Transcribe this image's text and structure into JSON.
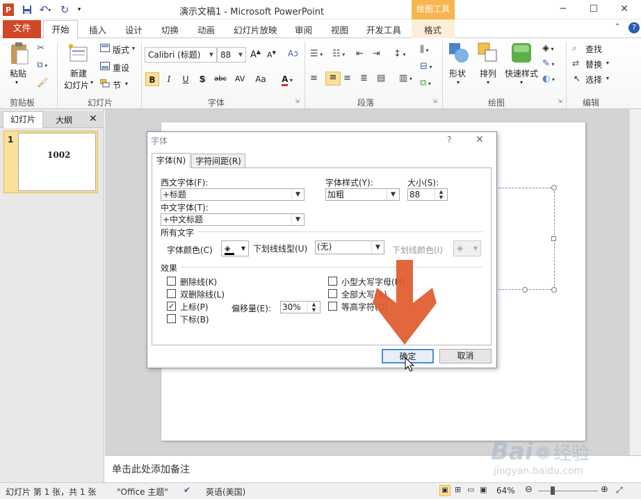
{
  "titlebar": {
    "title": "演示文稿1 - Microsoft PowerPoint",
    "drawing_tools": "绘图工具",
    "minimize": "─",
    "restore": "☐",
    "close": "✕"
  },
  "tabs": {
    "file": "文件",
    "home": "开始",
    "insert": "插入",
    "design": "设计",
    "transitions": "切换",
    "animations": "动画",
    "slideshow": "幻灯片放映",
    "review": "审阅",
    "view": "视图",
    "developer": "开发工具",
    "format": "格式"
  },
  "ribbon": {
    "clipboard": {
      "paste": "粘贴",
      "label": "剪贴板"
    },
    "slides": {
      "new_slide": "新建",
      "new_slide2": "幻灯片",
      "layout": "版式",
      "reset": "重设",
      "section": "节",
      "label": "幻灯片"
    },
    "font": {
      "name": "Calibri (标题)",
      "size": "88",
      "label": "字体",
      "bold": "B",
      "italic": "I",
      "underline": "U",
      "shadow": "S",
      "strike": "abc",
      "spacing": "AV",
      "case": "Aa",
      "color": "A"
    },
    "paragraph": {
      "label": "段落"
    },
    "drawing": {
      "shapes": "形状",
      "arrange": "排列",
      "quick_styles": "快速样式",
      "label": "绘图"
    },
    "editing": {
      "find": "查找",
      "replace": "替换",
      "select": "选择",
      "label": "编辑"
    }
  },
  "leftpane": {
    "tab_slides": "幻灯片",
    "tab_outline": "大纲",
    "slide_number": "1",
    "slide_text": "1002"
  },
  "notes": {
    "placeholder": "单击此处添加备注"
  },
  "statusbar": {
    "slide_info": "幻灯片 第 1 张，共 1 张",
    "theme": "\"Office 主题\"",
    "language": "英语(美国)",
    "zoom": "64%"
  },
  "dialog": {
    "title": "字体",
    "help": "?",
    "close": "✕",
    "tab_font": "字体(N)",
    "tab_spacing": "字符间距(R)",
    "latin_font_label": "西文字体(F):",
    "latin_font_value": "+标题",
    "asian_font_label": "中文字体(T):",
    "asian_font_value": "+中文标题",
    "style_label": "字体样式(Y):",
    "style_value": "加粗",
    "size_label": "大小(S):",
    "size_value": "88",
    "all_text": "所有文字",
    "font_color_label": "字体颜色(C)",
    "underline_style_label": "下划线线型(U)",
    "underline_style_value": "(无)",
    "underline_color_label": "下划线颜色(I)",
    "effects": "效果",
    "strikethrough": "删除线(K)",
    "double_strikethrough": "双删除线(L)",
    "superscript": "上标(P)",
    "subscript": "下标(B)",
    "offset_label": "偏移量(E):",
    "offset_value": "30%",
    "small_caps": "小型大写字母(M)",
    "all_caps": "全部大写(A)",
    "equalize_height": "等高字符(Q)",
    "ok": "确定",
    "cancel": "取消"
  },
  "watermark": {
    "brand": "Bai",
    "brand2": "经验",
    "url": "jingyan.baidu.com"
  }
}
